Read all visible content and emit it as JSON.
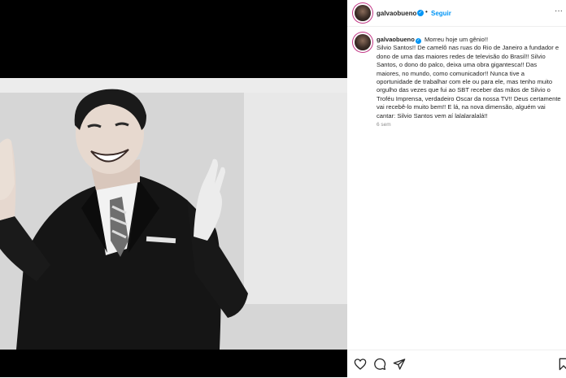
{
  "post": {
    "username": "galvaobueno",
    "follow_label": "Seguir",
    "more_label": "···",
    "caption_lines": [
      "Morreu hoje um gênio!!",
      "Silvio Santos!! De camelô nas ruas do Rio de Janeiro a fundador e dono de uma das maiores redes de televisão do Brasil!! Silvio Santos, o dono do palco, deixa uma obra gigantesca!! Das maiores, no mundo, como comunicador!! Nunca tive a oportunidade de trabalhar com ele ou para ele, mas tenho muito orgulho das vezes que fui ao SBT receber das mãos de Silvio o Troféu Imprensa, verdadeiro Oscar da nossa TV!! Deus certamente vai recebê-lo muito bem!! E lá, na nova dimensão, alguém vai cantar: Silvio Santos vem aí lalalaralalá!!"
    ],
    "time_ago": "6 sem"
  },
  "icons": {
    "verified": "verified-badge-icon",
    "like": "heart-icon",
    "comment": "comment-icon",
    "share": "send-icon",
    "save": "bookmark-icon"
  },
  "colors": {
    "accent": "#0095f6",
    "text": "#262626",
    "muted": "#8e8e8e"
  }
}
